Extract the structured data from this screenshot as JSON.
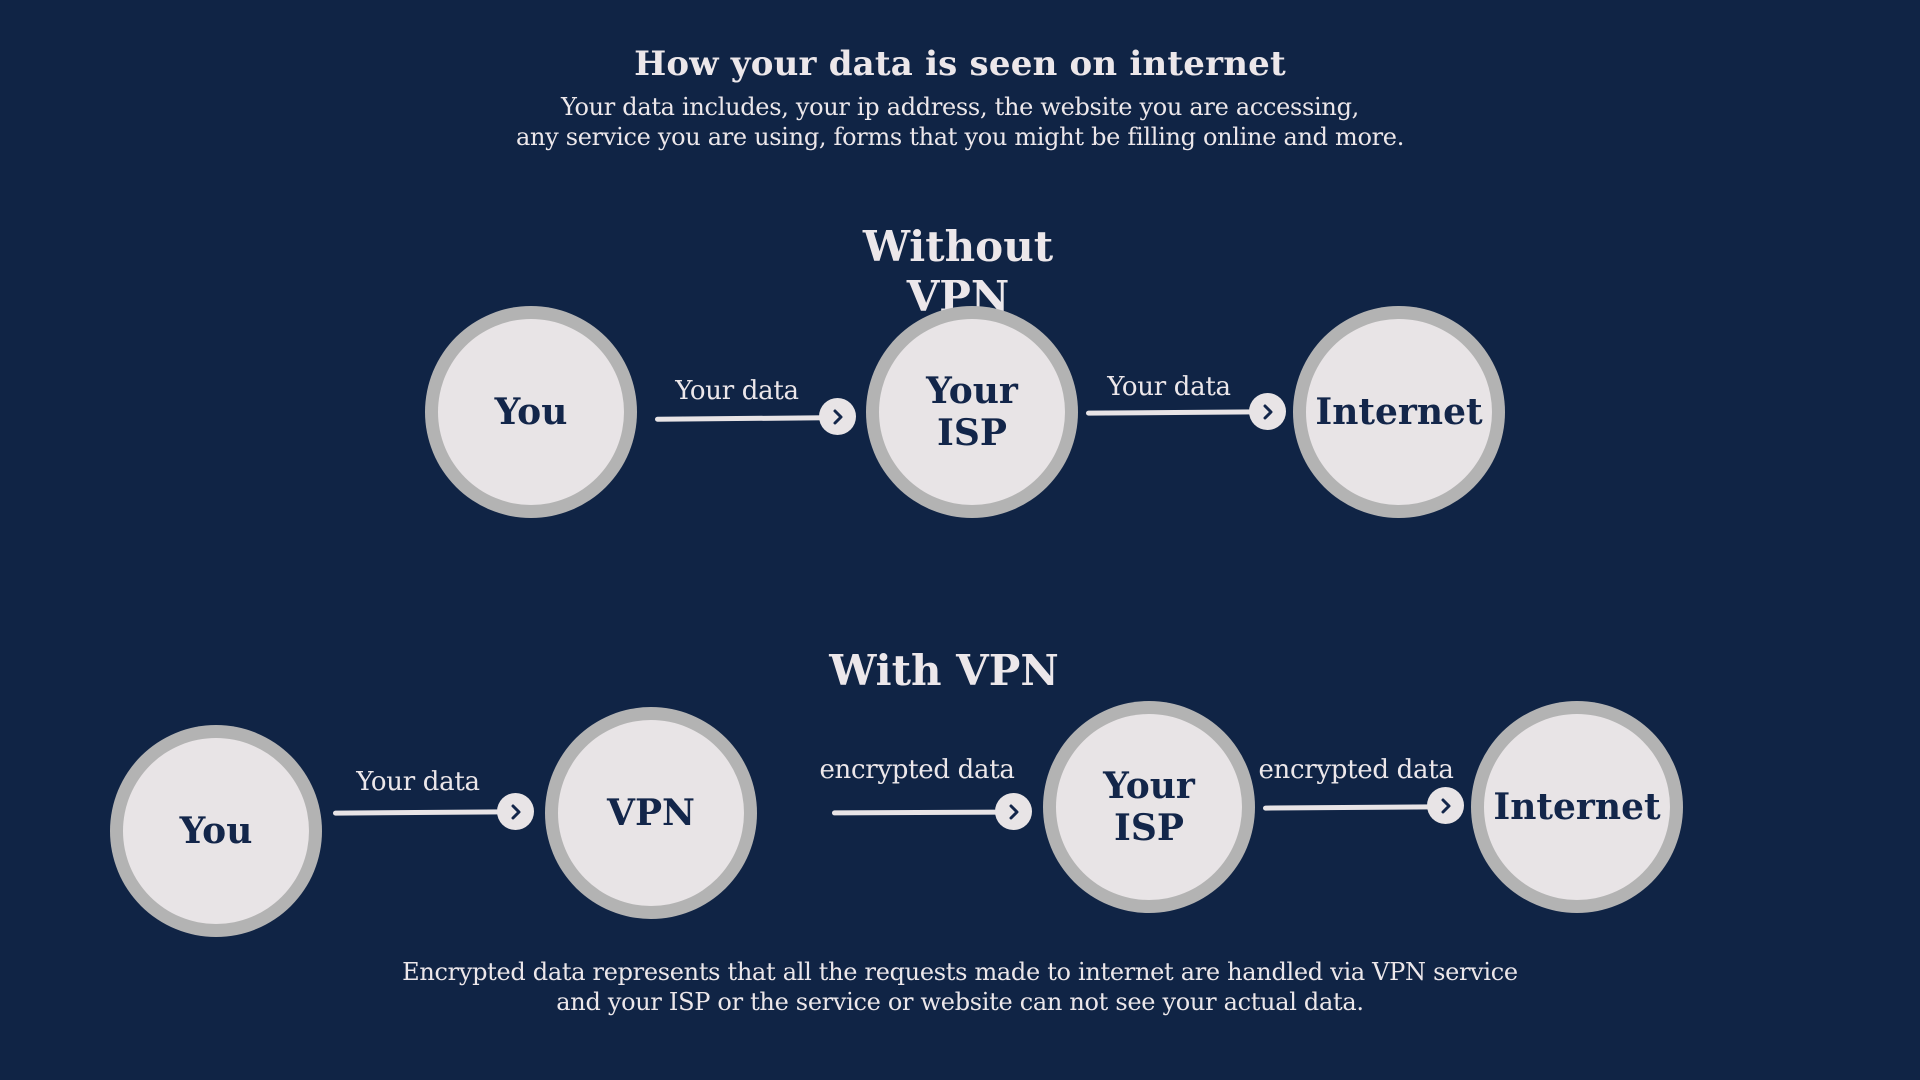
{
  "header": {
    "title": "How your data is seen on internet",
    "subtitle_lines": [
      "Your data includes, your ip address, the website you are accessing,",
      "any service you are using, forms that you might be filling online and more."
    ]
  },
  "sections": [
    {
      "title": "Without VPN",
      "nodes": [
        {
          "label": "You"
        },
        {
          "label": "Your\nISP"
        },
        {
          "label": "Internet"
        }
      ],
      "edges": [
        {
          "label": "Your data",
          "icon": "chevron-right-icon"
        },
        {
          "label": "Your data",
          "icon": "chevron-right-icon"
        }
      ]
    },
    {
      "title": "With VPN",
      "nodes": [
        {
          "label": "You"
        },
        {
          "label": "VPN"
        },
        {
          "label": "Your\nISP"
        },
        {
          "label": "Internet"
        }
      ],
      "edges": [
        {
          "label": "Your data",
          "icon": "chevron-right-icon"
        },
        {
          "label": "encrypted data",
          "icon": "chevron-right-icon"
        },
        {
          "label": "encrypted data",
          "icon": "chevron-right-icon"
        }
      ]
    }
  ],
  "footer": {
    "lines": [
      "Encrypted data represents that all the requests made to internet are handled via VPN service",
      "and your ISP or the service or website can not see your actual data."
    ]
  },
  "colors": {
    "background": "#102445",
    "node_fill": "#e8e4e6",
    "node_ring": "#b3b3b3",
    "node_text": "#13264a",
    "light_text": "#ece7ea"
  }
}
